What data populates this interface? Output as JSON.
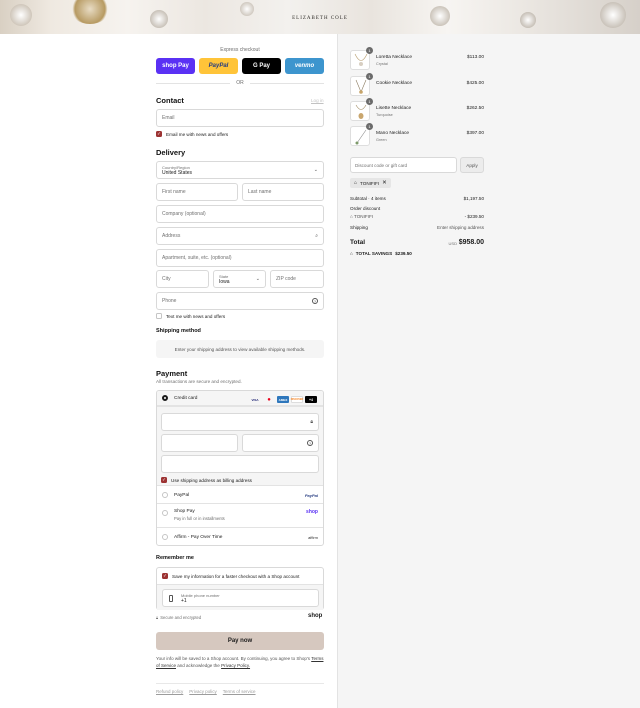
{
  "header": {
    "brand": "ELIZABETH COLE"
  },
  "express": {
    "title": "Express checkout",
    "buttons": [
      {
        "label": "shop Pay",
        "color": "#5a31f4",
        "text_color": "#ffffff"
      },
      {
        "label": "PayPal",
        "color": "#ffc439",
        "text_color": "#253b80"
      },
      {
        "label": "G Pay",
        "color": "#000000",
        "text_color": "#ffffff"
      },
      {
        "label": "venmo",
        "color": "#3d95ce",
        "text_color": "#ffffff"
      }
    ],
    "or": "OR"
  },
  "contact": {
    "heading": "Contact",
    "login_link": "Log in",
    "email_placeholder": "Email",
    "news_label": "Email me with news and offers",
    "news_checked": true
  },
  "delivery": {
    "heading": "Delivery",
    "country_label": "Country/Region",
    "country_value": "United States",
    "first_name": "First name",
    "last_name": "Last name",
    "company": "Company (optional)",
    "address": "Address",
    "apartment": "Apartment, suite, etc. (optional)",
    "city": "City",
    "state_label": "State",
    "state_value": "Iowa",
    "zip": "ZIP code",
    "phone": "Phone",
    "text_label": "Text me with news and offers",
    "text_checked": false
  },
  "shipping_method": {
    "heading": "Shipping method",
    "note": "Enter your shipping address to view available shipping methods."
  },
  "payment": {
    "heading": "Payment",
    "subheading": "All transactions are secure and encrypted.",
    "credit_card_label": "Credit card",
    "card_logos": [
      "VISA",
      "MC",
      "AMEX",
      "DISCOVER",
      "+4"
    ],
    "use_shipping_label": "Use shipping address as billing address",
    "options": [
      {
        "label": "PayPal",
        "badge": "PayPal",
        "sub": ""
      },
      {
        "label": "Shop Pay",
        "badge": "shop",
        "sub": "Pay in full or in installments"
      },
      {
        "label": "Affirm - Pay Over Time",
        "badge": "affirm",
        "sub": ""
      }
    ]
  },
  "remember": {
    "heading": "Remember me",
    "save_label": "Save my information for a faster checkout with a Shop account",
    "phone_label": "Mobile phone number",
    "phone_prefix": "+1",
    "secure_label": "Secure and encrypted",
    "shop_badge": "shop"
  },
  "pay_now": "Pay now",
  "legal": {
    "text1": "Your info will be saved to a Shop account. By continuing, you agree to Shop's",
    "terms": "Terms of Service",
    "text2": "and acknowledge the",
    "privacy": "Privacy Policy."
  },
  "footer_links": [
    "Refund policy",
    "Privacy policy",
    "Terms of service"
  ],
  "summary": {
    "items": [
      {
        "name": "Loretta Necklace",
        "variant": "Crystal",
        "price": "$113.00",
        "qty": "1"
      },
      {
        "name": "Cookie Necklace",
        "variant": "",
        "price": "$425.00",
        "qty": "1"
      },
      {
        "name": "Lisette Necklace",
        "variant": "Turquoise",
        "price": "$262.50",
        "qty": "1"
      },
      {
        "name": "Mano Necklace",
        "variant": "Green",
        "price": "$397.00",
        "qty": "1"
      }
    ],
    "discount_placeholder": "Discount code or gift card",
    "apply_label": "Apply",
    "applied_code": "TONIFIFI",
    "subtotal_label": "Subtotal · 4 items",
    "subtotal_value": "$1,197.50",
    "order_discount_label": "Order discount",
    "discount_code_label": "TONIFIFI",
    "discount_value": "- $239.50",
    "shipping_label": "Shipping",
    "shipping_value": "Enter shipping address",
    "total_label": "Total",
    "currency": "USD",
    "total_value": "$958.00",
    "savings_label": "TOTAL SAVINGS",
    "savings_value": "$239.50"
  }
}
